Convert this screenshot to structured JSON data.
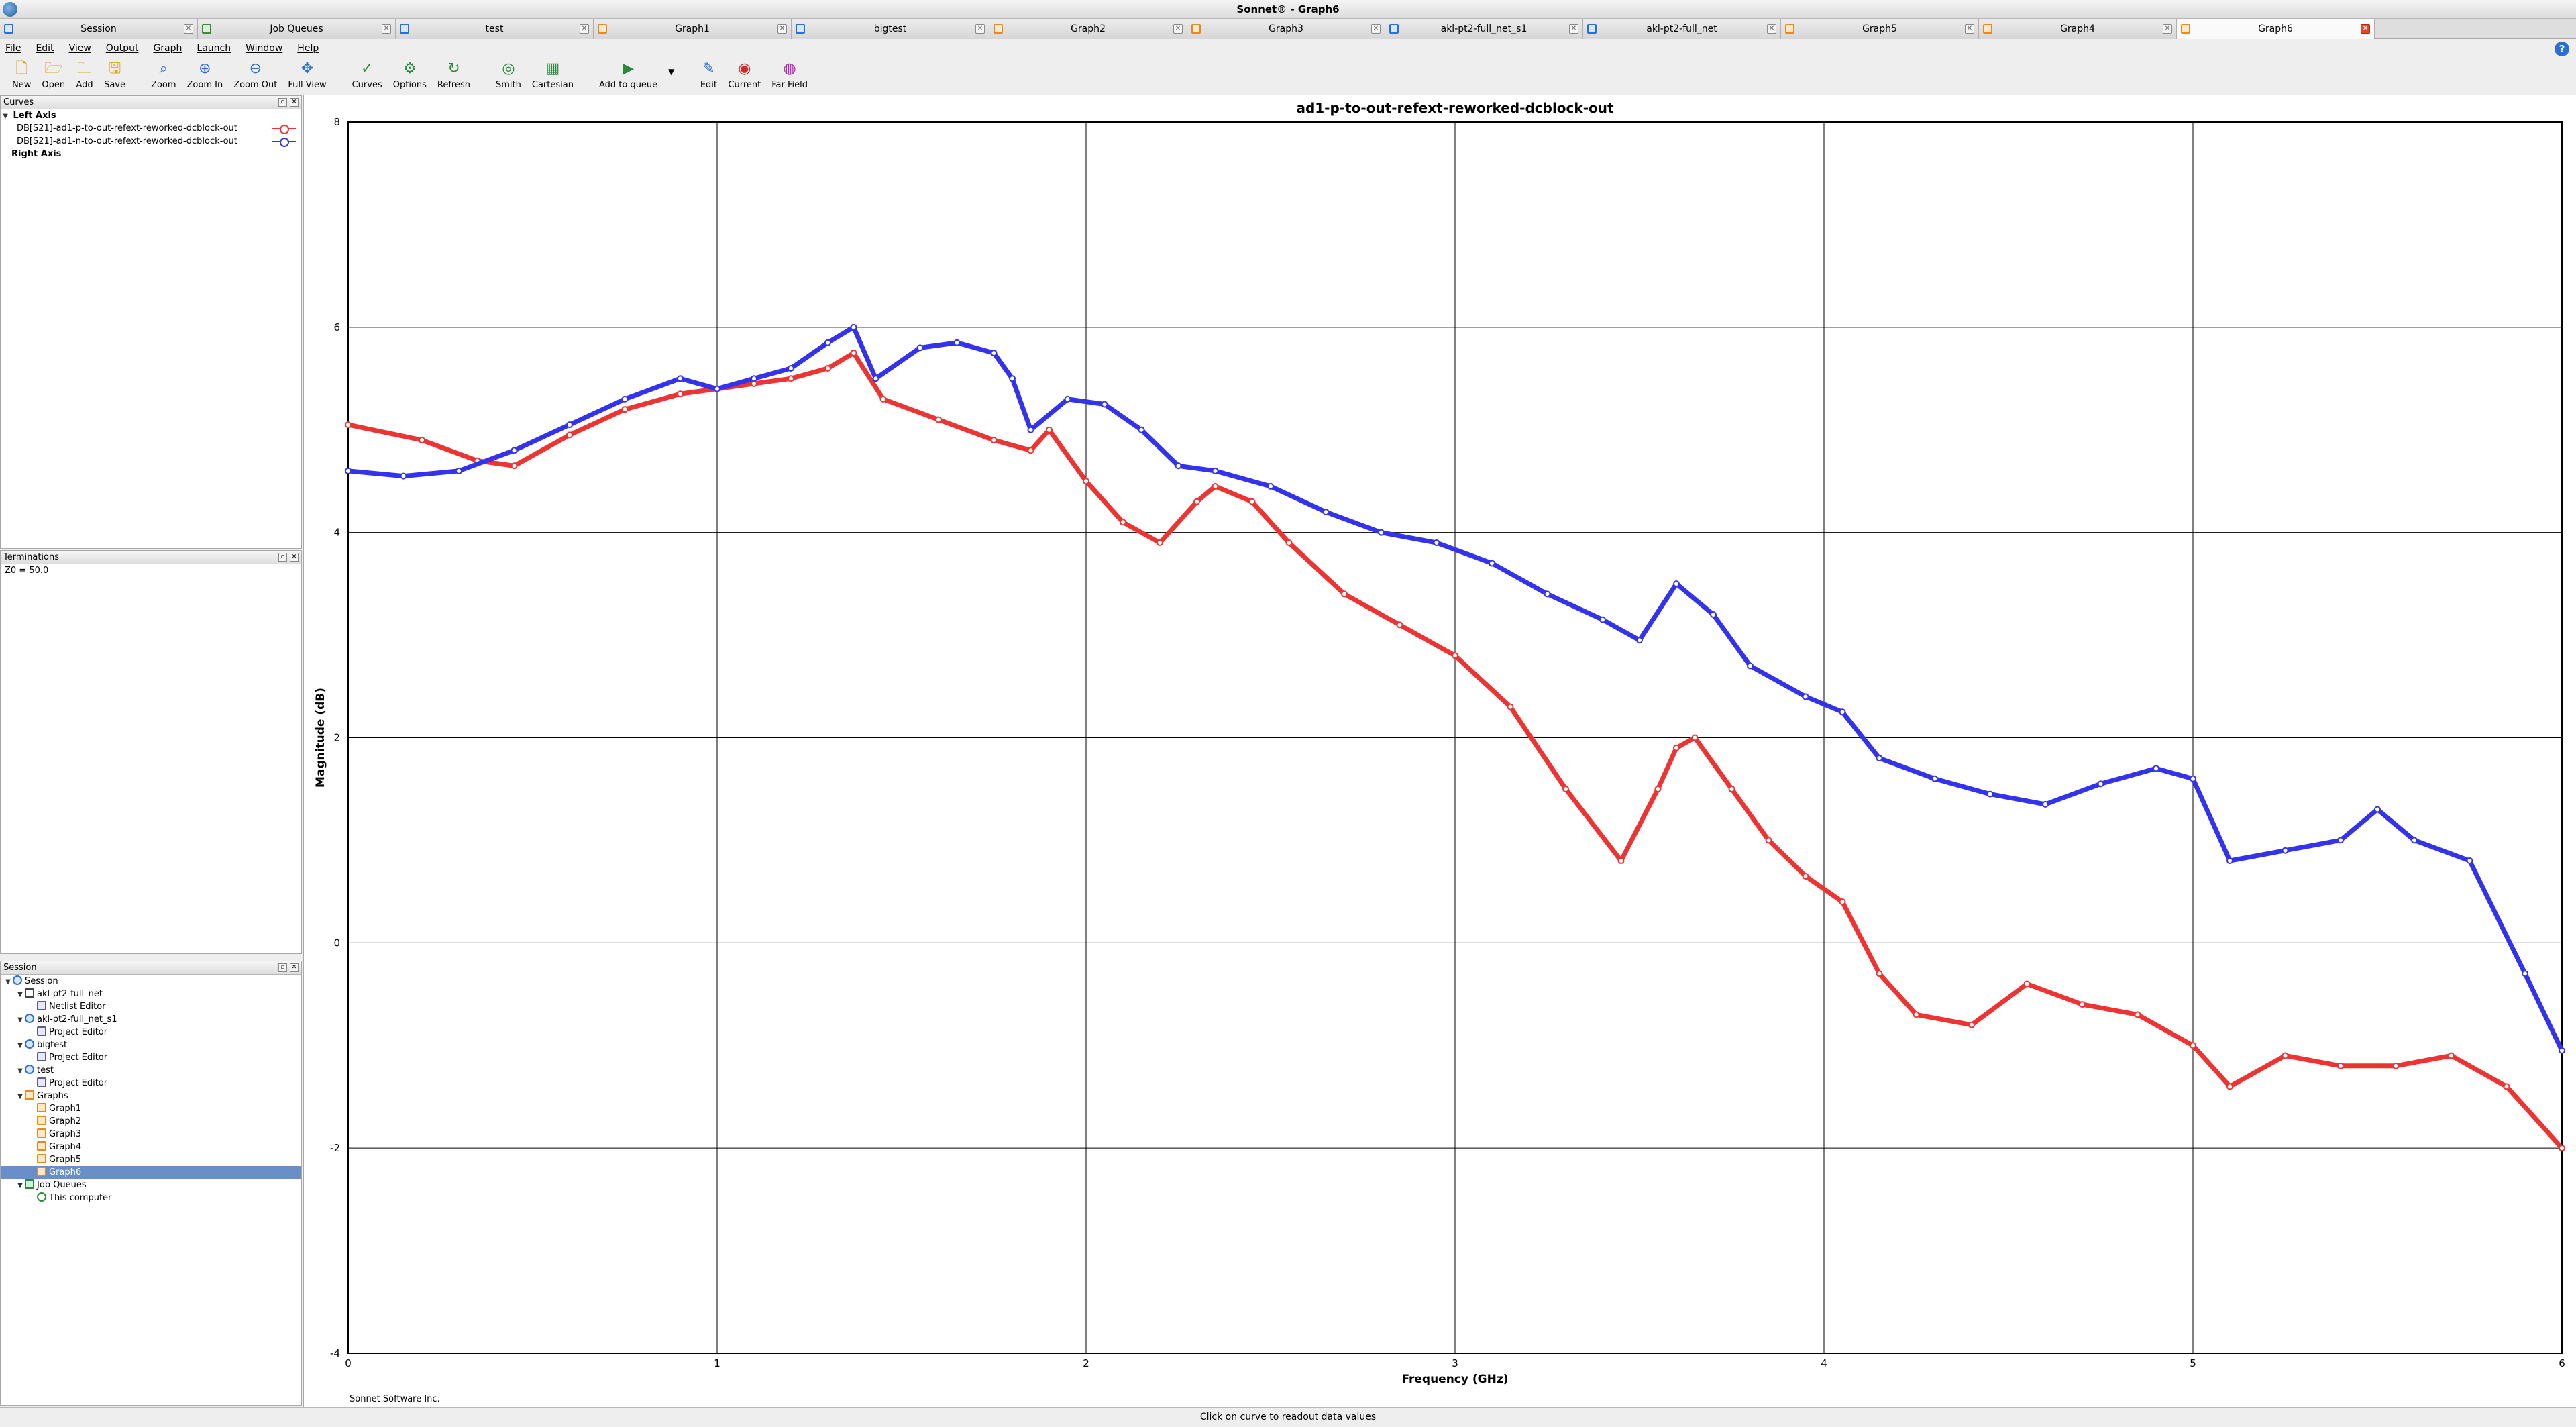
{
  "window": {
    "title": "Sonnet® - Graph6"
  },
  "tabs": [
    {
      "label": "Session",
      "icon": "session-icon",
      "active": false
    },
    {
      "label": "Job Queues",
      "icon": "job-queue-icon",
      "active": false
    },
    {
      "label": "test",
      "icon": "project-icon",
      "active": false
    },
    {
      "label": "Graph1",
      "icon": "graph-icon",
      "active": false
    },
    {
      "label": "bigtest",
      "icon": "project-icon",
      "active": false
    },
    {
      "label": "Graph2",
      "icon": "graph-icon",
      "active": false
    },
    {
      "label": "Graph3",
      "icon": "graph-icon",
      "active": false
    },
    {
      "label": "akl-pt2-full_net_s1",
      "icon": "project-icon",
      "active": false
    },
    {
      "label": "akl-pt2-full_net",
      "icon": "netlist-icon",
      "active": false
    },
    {
      "label": "Graph5",
      "icon": "graph-icon",
      "active": false
    },
    {
      "label": "Graph4",
      "icon": "graph-icon",
      "active": false
    },
    {
      "label": "Graph6",
      "icon": "graph-icon",
      "active": true
    }
  ],
  "menu": [
    "File",
    "Edit",
    "View",
    "Output",
    "Graph",
    "Launch",
    "Window",
    "Help"
  ],
  "toolbar": [
    {
      "label": "New",
      "icon": "new-file-icon"
    },
    {
      "label": "Open",
      "icon": "open-folder-icon"
    },
    {
      "label": "Add",
      "icon": "add-folder-icon"
    },
    {
      "label": "Save",
      "icon": "save-icon"
    },
    {
      "label": "Zoom",
      "icon": "zoom-icon"
    },
    {
      "label": "Zoom In",
      "icon": "zoom-in-icon"
    },
    {
      "label": "Zoom Out",
      "icon": "zoom-out-icon"
    },
    {
      "label": "Full View",
      "icon": "full-view-icon"
    },
    {
      "label": "Curves",
      "icon": "curves-icon"
    },
    {
      "label": "Options",
      "icon": "options-gear-icon"
    },
    {
      "label": "Refresh",
      "icon": "refresh-icon"
    },
    {
      "label": "Smith",
      "icon": "smith-chart-icon"
    },
    {
      "label": "Cartesian",
      "icon": "cartesian-grid-icon"
    },
    {
      "label": "Add to queue",
      "icon": "add-to-queue-icon"
    },
    {
      "label": "Edit",
      "icon": "edit-icon"
    },
    {
      "label": "Current",
      "icon": "current-icon"
    },
    {
      "label": "Far Field",
      "icon": "far-field-icon"
    }
  ],
  "curves_panel": {
    "title": "Curves",
    "left_axis_label": "Left Axis",
    "right_axis_label": "Right Axis",
    "curves": [
      {
        "label": "DB[S21]-ad1-p-to-out-refext-reworked-dcblock-out",
        "color": "#ee3333"
      },
      {
        "label": "DB[S21]-ad1-n-to-out-refext-reworked-dcblock-out",
        "color": "#3333ee"
      }
    ]
  },
  "terminations_panel": {
    "title": "Terminations",
    "text": "Z0 = 50.0"
  },
  "session_panel": {
    "title": "Session",
    "items": [
      {
        "label": "Session",
        "level": 0,
        "icon": "session-icon"
      },
      {
        "label": "akl-pt2-full_net",
        "level": 1,
        "icon": "netlist-icon"
      },
      {
        "label": "Netlist Editor",
        "level": 2,
        "icon": "netlist-editor-icon"
      },
      {
        "label": "akl-pt2-full_net_s1",
        "level": 1,
        "icon": "project-icon"
      },
      {
        "label": "Project Editor",
        "level": 2,
        "icon": "project-editor-icon"
      },
      {
        "label": "bigtest",
        "level": 1,
        "icon": "project-icon"
      },
      {
        "label": "Project Editor",
        "level": 2,
        "icon": "project-editor-icon"
      },
      {
        "label": "test",
        "level": 1,
        "icon": "project-icon"
      },
      {
        "label": "Project Editor",
        "level": 2,
        "icon": "project-editor-icon"
      },
      {
        "label": "Graphs",
        "level": 1,
        "icon": "graphs-folder-icon"
      },
      {
        "label": "Graph1",
        "level": 2,
        "icon": "graph-icon"
      },
      {
        "label": "Graph2",
        "level": 2,
        "icon": "graph-icon"
      },
      {
        "label": "Graph3",
        "level": 2,
        "icon": "graph-icon"
      },
      {
        "label": "Graph4",
        "level": 2,
        "icon": "graph-icon"
      },
      {
        "label": "Graph5",
        "level": 2,
        "icon": "graph-icon"
      },
      {
        "label": "Graph6",
        "level": 2,
        "icon": "graph-icon",
        "selected": true
      },
      {
        "label": "Job Queues",
        "level": 1,
        "icon": "job-queue-icon"
      },
      {
        "label": "This computer",
        "level": 2,
        "icon": "computer-check-icon"
      }
    ]
  },
  "status_text": "Click on curve to readout data values",
  "graph_footer": "Sonnet Software Inc.",
  "chart_data": {
    "type": "line",
    "title": "ad1-p-to-out-refext-reworked-dcblock-out",
    "xlabel": "Frequency (GHz)",
    "ylabel": "Magnitude (dB)",
    "xlim": [
      0,
      6
    ],
    "ylim": [
      -4,
      8
    ],
    "xticks": [
      0,
      1,
      2,
      3,
      4,
      5,
      6
    ],
    "yticks": [
      -4,
      -2,
      0,
      2,
      4,
      6,
      8
    ],
    "grid": true,
    "series": [
      {
        "color": "#ee3333",
        "x": [
          0,
          0.2,
          0.35,
          0.45,
          0.6,
          0.75,
          0.9,
          1.0,
          1.1,
          1.2,
          1.3,
          1.37,
          1.45,
          1.6,
          1.75,
          1.85,
          1.9,
          2.0,
          2.1,
          2.2,
          2.3,
          2.35,
          2.45,
          2.55,
          2.7,
          2.85,
          3.0,
          3.15,
          3.3,
          3.45,
          3.55,
          3.6,
          3.65,
          3.75,
          3.85,
          3.95,
          4.05,
          4.15,
          4.25,
          4.4,
          4.55,
          4.7,
          4.85,
          5.0,
          5.1,
          5.25,
          5.4,
          5.55,
          5.7,
          5.85,
          6.0
        ],
        "y": [
          5.05,
          4.9,
          4.7,
          4.65,
          4.95,
          5.2,
          5.35,
          5.4,
          5.45,
          5.5,
          5.6,
          5.75,
          5.3,
          5.1,
          4.9,
          4.8,
          5.0,
          4.5,
          4.1,
          3.9,
          4.3,
          4.45,
          4.3,
          3.9,
          3.4,
          3.1,
          2.8,
          2.3,
          1.5,
          0.8,
          1.5,
          1.9,
          2.0,
          1.5,
          1.0,
          0.65,
          0.4,
          -0.3,
          -0.7,
          -0.8,
          -0.4,
          -0.6,
          -0.7,
          -1.0,
          -1.4,
          -1.1,
          -1.2,
          -1.2,
          -1.1,
          -1.4,
          -2.0
        ]
      },
      {
        "color": "#3333ee",
        "x": [
          0,
          0.15,
          0.3,
          0.45,
          0.6,
          0.75,
          0.9,
          1.0,
          1.1,
          1.2,
          1.3,
          1.37,
          1.43,
          1.55,
          1.65,
          1.75,
          1.8,
          1.85,
          1.95,
          2.05,
          2.15,
          2.25,
          2.35,
          2.5,
          2.65,
          2.8,
          2.95,
          3.1,
          3.25,
          3.4,
          3.5,
          3.6,
          3.7,
          3.8,
          3.95,
          4.05,
          4.15,
          4.3,
          4.45,
          4.6,
          4.75,
          4.9,
          5.0,
          5.1,
          5.25,
          5.4,
          5.5,
          5.6,
          5.75,
          5.9,
          6.0
        ],
        "y": [
          4.6,
          4.55,
          4.6,
          4.8,
          5.05,
          5.3,
          5.5,
          5.4,
          5.5,
          5.6,
          5.85,
          6.0,
          5.5,
          5.8,
          5.85,
          5.75,
          5.5,
          5.0,
          5.3,
          5.25,
          5.0,
          4.65,
          4.6,
          4.45,
          4.2,
          4.0,
          3.9,
          3.7,
          3.4,
          3.15,
          2.95,
          3.5,
          3.2,
          2.7,
          2.4,
          2.25,
          1.8,
          1.6,
          1.45,
          1.35,
          1.55,
          1.7,
          1.6,
          0.8,
          0.9,
          1.0,
          1.3,
          1.0,
          0.8,
          -0.3,
          -1.05
        ]
      }
    ]
  }
}
